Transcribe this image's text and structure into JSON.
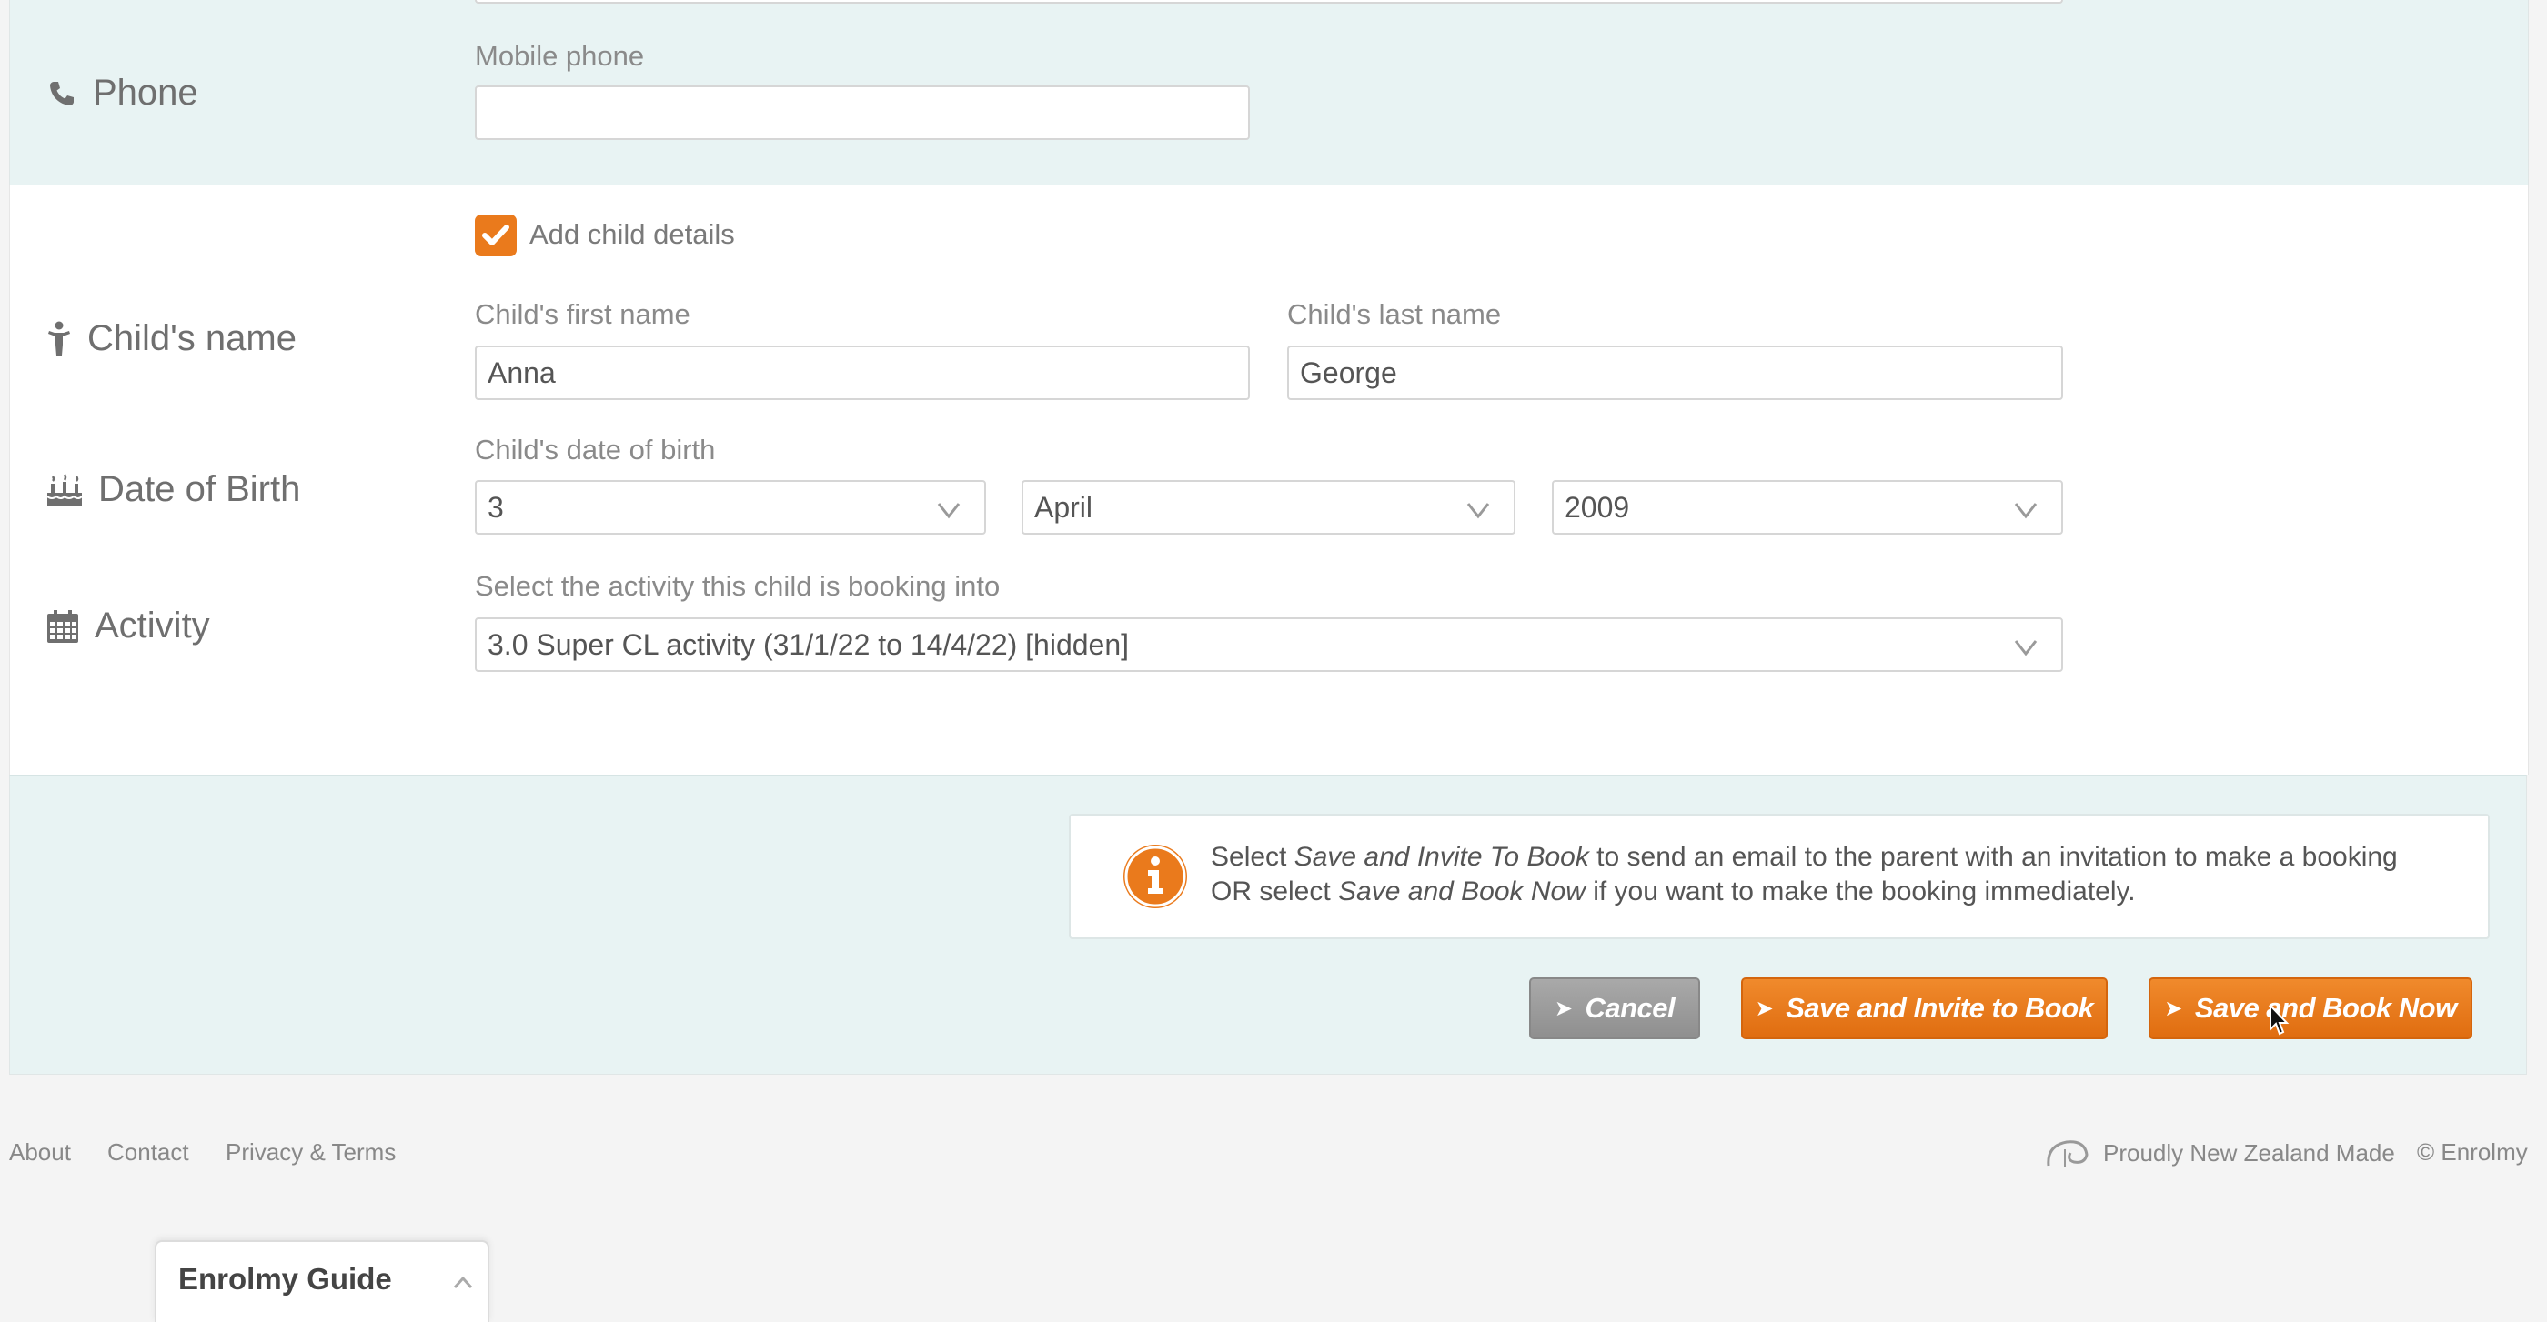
{
  "phone": {
    "label": "Phone",
    "icon": "phone-icon",
    "mobile_label": "Mobile phone",
    "mobile_value": ""
  },
  "child": {
    "add_details_label": "Add child details",
    "add_details_checked": true,
    "name_row_label": "Child's name",
    "name_icon": "child-icon",
    "first_name_label": "Child's first name",
    "first_name_value": "Anna",
    "last_name_label": "Child's last name",
    "last_name_value": "George",
    "dob_row_label": "Date of Birth",
    "dob_icon": "birthday-cake-icon",
    "dob_label": "Child's date of birth",
    "dob_day": "3",
    "dob_month": "April",
    "dob_year": "2009",
    "activity_row_label": "Activity",
    "activity_icon": "calendar-icon",
    "activity_label": "Select the activity this child is booking into",
    "activity_value": "3.0 Super CL activity (31/1/22 to 14/4/22) [hidden]"
  },
  "info": {
    "icon": "info-icon",
    "line1_pre": "Select ",
    "line1_em": "Save and Invite To Book",
    "line1_post": " to send an email to the parent with an invitation to make a booking",
    "line2_pre": "OR select ",
    "line2_em": "Save and Book Now",
    "line2_post": " if you want to make the booking immediately."
  },
  "actions": {
    "cancel": "Cancel",
    "invite": "Save and Invite to Book",
    "book_now": "Save and Book Now"
  },
  "footer": {
    "about": "About",
    "contact": "Contact",
    "privacy": "Privacy & Terms",
    "nz_made": "Proudly New Zealand Made",
    "copyright": "© Enrolmy"
  },
  "guide": {
    "title": "Enrolmy Guide"
  },
  "colors": {
    "accent_orange": "#ea7a1c",
    "teal_background": "#e8f3f3",
    "cancel_grey": "#9b9b9b"
  }
}
